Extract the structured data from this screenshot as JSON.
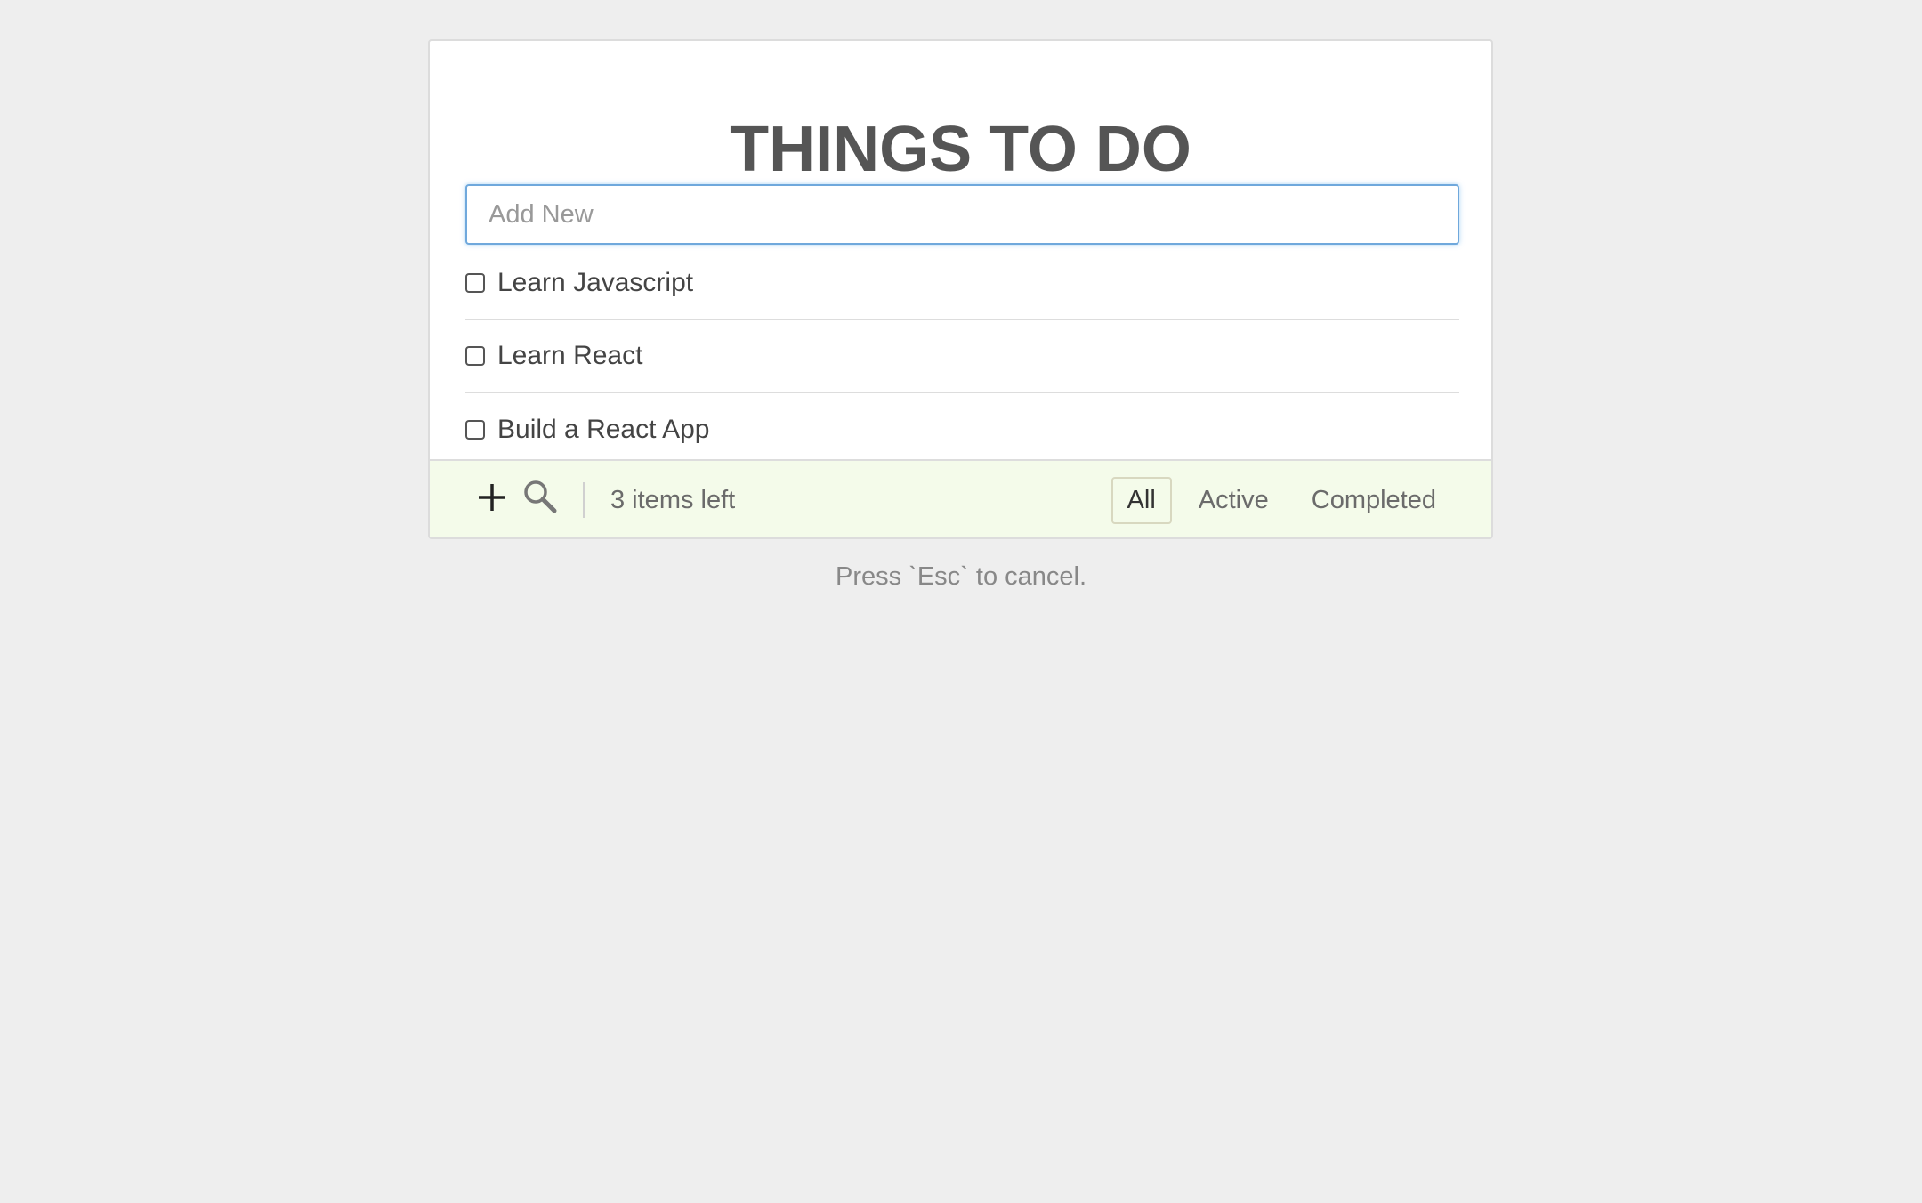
{
  "app": {
    "title": "THINGS TO DO"
  },
  "input": {
    "placeholder": "Add New",
    "value": ""
  },
  "todos": [
    {
      "label": "Learn Javascript",
      "completed": false
    },
    {
      "label": "Learn React",
      "completed": false
    },
    {
      "label": "Build a React App",
      "completed": false
    }
  ],
  "footer": {
    "add_icon": "plus-icon",
    "search_icon": "search-icon",
    "items_left": "3 items left",
    "filters": [
      {
        "label": "All",
        "selected": true
      },
      {
        "label": "Active",
        "selected": false
      },
      {
        "label": "Completed",
        "selected": false
      }
    ]
  },
  "hint": "Press `Esc` to cancel.",
  "colors": {
    "background": "#eeeeee",
    "card": "#ffffff",
    "footer_background": "#f4fbea",
    "input_focus_border": "#6fa8dc",
    "title_text": "#555555"
  }
}
